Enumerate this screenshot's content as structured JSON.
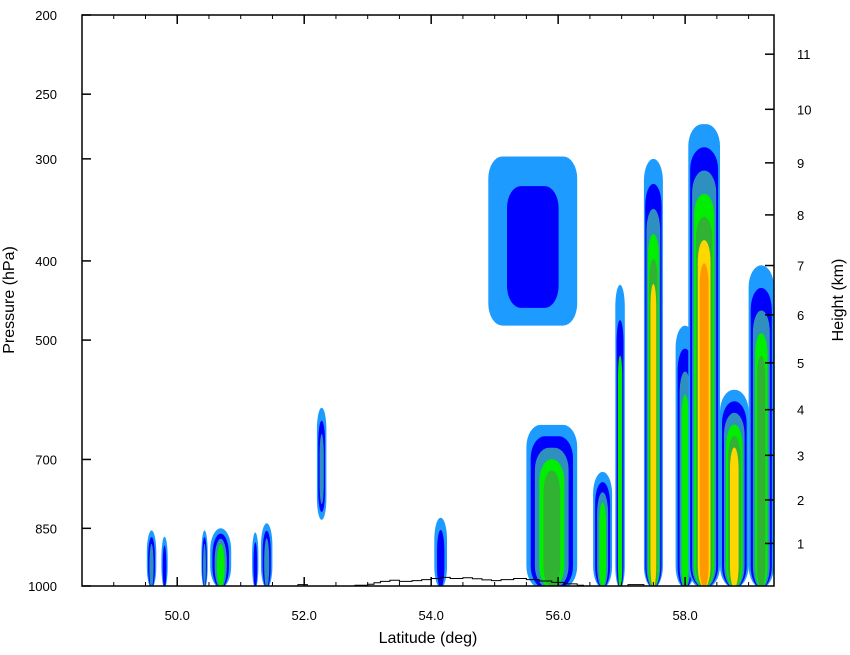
{
  "chart_data": {
    "type": "contour",
    "title": "",
    "xlabel": "Latitude (deg)",
    "ylabel_left": "Pressure (hPa)",
    "ylabel_right": "Height (km)",
    "x_range": [
      48.5,
      59.4
    ],
    "x_ticks": [
      "50.0",
      "52.0",
      "54.0",
      "56.0",
      "58.0"
    ],
    "x_tick_values": [
      50,
      52,
      54,
      56,
      58
    ],
    "y_scale": "log",
    "y_range": [
      1000,
      200
    ],
    "y_ticks": [
      "200",
      "250",
      "300",
      "400",
      "500",
      "700",
      "850",
      "1000"
    ],
    "y_tick_values": [
      200,
      250,
      300,
      400,
      500,
      700,
      850,
      1000
    ],
    "height_ticks": [
      "1",
      "2",
      "3",
      "4",
      "5",
      "6",
      "7",
      "8",
      "9",
      "10",
      "11"
    ],
    "height_tick_values": [
      1,
      2,
      3,
      4,
      5,
      6,
      7,
      8,
      9,
      10,
      11
    ],
    "colors": {
      "level1": "#1e9bff",
      "level2": "#0000ff",
      "level3": "#2f8fbf",
      "level4": "#00ee00",
      "level5": "#32b232",
      "level6": "#ffd700",
      "level7": "#ff9900",
      "terrain": "#000000"
    },
    "regions": [
      {
        "name": "cell-49.6",
        "x": [
          49.52,
          49.67
        ],
        "ptop": 855,
        "layers": [
          1,
          2,
          3
        ]
      },
      {
        "name": "cell-49.8",
        "x": [
          49.75,
          49.85
        ],
        "ptop": 870,
        "layers": [
          1,
          2
        ]
      },
      {
        "name": "cell-50.5",
        "x": [
          50.38,
          50.48
        ],
        "ptop": 855,
        "layers": [
          1,
          2,
          3
        ]
      },
      {
        "name": "cell-50.7",
        "x": [
          50.52,
          50.85
        ],
        "ptop": 850,
        "layers": [
          1,
          2,
          3,
          4
        ]
      },
      {
        "name": "cell-51.3",
        "x": [
          51.18,
          51.28
        ],
        "ptop": 860,
        "layers": [
          1,
          2
        ]
      },
      {
        "name": "cell-51.4",
        "x": [
          51.32,
          51.5
        ],
        "ptop": 838,
        "layers": [
          1,
          2,
          3
        ]
      },
      {
        "name": "cell-52.3",
        "x": [
          52.2,
          52.35
        ],
        "ptop": 605,
        "pbot": 830,
        "layers": [
          1,
          2,
          3
        ]
      },
      {
        "name": "cell-54.2",
        "x": [
          54.05,
          54.25
        ],
        "ptop": 825,
        "layers": [
          1,
          2
        ]
      },
      {
        "name": "anvil-55.4",
        "x": [
          54.9,
          56.3
        ],
        "ptop": 298,
        "pbot": 480,
        "layers": [
          1,
          2
        ]
      },
      {
        "name": "cell-55.9",
        "x": [
          55.5,
          56.3
        ],
        "ptop": 635,
        "layers": [
          1,
          2,
          3,
          4,
          5
        ]
      },
      {
        "name": "cell-56.7",
        "x": [
          56.55,
          56.85
        ],
        "ptop": 725,
        "layers": [
          1,
          2,
          3,
          4
        ]
      },
      {
        "name": "cell-57.0",
        "x": [
          56.9,
          57.05
        ],
        "ptop": 428,
        "layers": [
          1,
          2,
          4
        ]
      },
      {
        "name": "cell-57.5",
        "x": [
          57.35,
          57.65
        ],
        "ptop": 300,
        "layers": [
          1,
          2,
          3,
          4,
          5,
          6
        ]
      },
      {
        "name": "cell-58.0",
        "x": [
          57.85,
          58.15
        ],
        "ptop": 480,
        "layers": [
          1,
          2,
          3,
          4
        ]
      },
      {
        "name": "cell-58.3",
        "x": [
          58.05,
          58.55
        ],
        "ptop": 272,
        "layers": [
          1,
          2,
          3,
          4,
          5,
          6,
          7
        ]
      },
      {
        "name": "cell-58.8",
        "x": [
          58.55,
          59.0
        ],
        "ptop": 575,
        "layers": [
          1,
          2,
          3,
          4,
          5,
          6
        ]
      },
      {
        "name": "cell-59.2",
        "x": [
          59.0,
          59.4
        ],
        "ptop": 405,
        "layers": [
          1,
          2,
          3,
          4,
          5
        ]
      }
    ]
  }
}
